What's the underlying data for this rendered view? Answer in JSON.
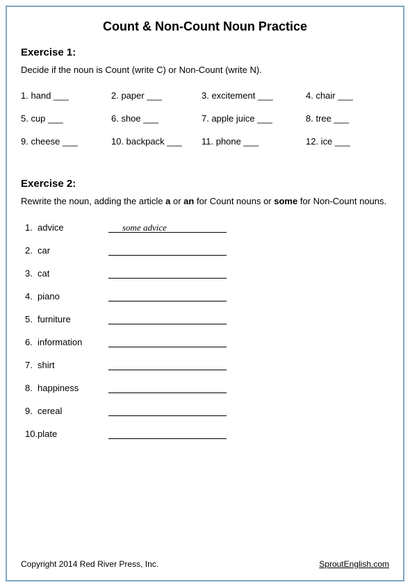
{
  "title": "Count & Non-Count Noun Practice",
  "exercise1": {
    "heading": "Exercise 1:",
    "instructions": "Decide if the noun is Count (write C) or Non-Count (write N).",
    "items": [
      "1. hand ___",
      "2. paper ___",
      "3. excitement ___",
      "4. chair ___",
      "5. cup ___",
      "6. shoe ___",
      "7. apple juice ___",
      "8. tree ___",
      "9. cheese ___",
      "10. backpack ___",
      "11. phone ___",
      "12. ice ___"
    ]
  },
  "exercise2": {
    "heading": "Exercise 2:",
    "instructions_pre": "Rewrite the noun, adding the article ",
    "instructions_bold1": "a",
    "instructions_mid1": " or ",
    "instructions_bold2": "an",
    "instructions_mid2": " for Count nouns or ",
    "instructions_bold3": "some",
    "instructions_post": " for Non-Count nouns.",
    "items": [
      {
        "num": "1.",
        "word": "advice",
        "answer": "some advice"
      },
      {
        "num": "2.",
        "word": "car",
        "answer": ""
      },
      {
        "num": "3.",
        "word": "cat",
        "answer": ""
      },
      {
        "num": "4.",
        "word": "piano",
        "answer": ""
      },
      {
        "num": "5.",
        "word": "furniture",
        "answer": ""
      },
      {
        "num": "6.",
        "word": "information",
        "answer": ""
      },
      {
        "num": "7.",
        "word": "shirt",
        "answer": ""
      },
      {
        "num": "8.",
        "word": "happiness",
        "answer": ""
      },
      {
        "num": "9.",
        "word": "cereal",
        "answer": ""
      },
      {
        "num": "10.",
        "word": "plate",
        "answer": ""
      }
    ]
  },
  "footer": {
    "copyright": "Copyright 2014 Red River Press, Inc.",
    "link": "SproutEnglish.com"
  }
}
